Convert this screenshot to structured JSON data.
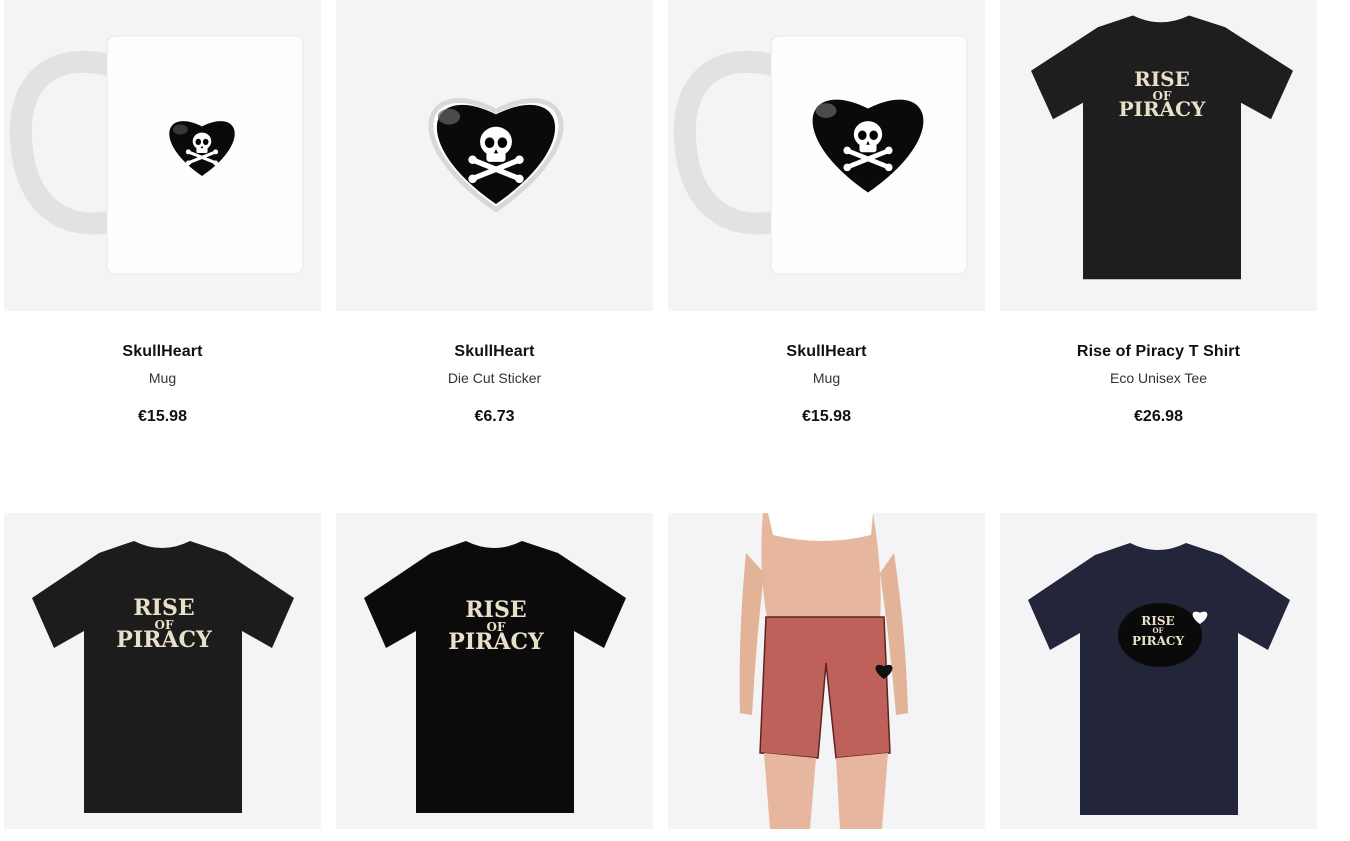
{
  "products": [
    {
      "title": "SkullHeart",
      "type": "Mug",
      "price": "€15.98"
    },
    {
      "title": "SkullHeart",
      "type": "Die Cut Sticker",
      "price": "€6.73"
    },
    {
      "title": "SkullHeart",
      "type": "Mug",
      "price": "€15.98"
    },
    {
      "title": "Rise of Piracy T Shirt",
      "type": "Eco Unisex Tee",
      "price": "€26.98"
    }
  ],
  "artwork": {
    "rise_line1": "RISE",
    "rise_line2": "OF",
    "rise_line3": "PIRACY"
  },
  "colors": {
    "card_bg": "#f4f4f7",
    "shirt_black": "#1a1a1a",
    "shirt_navy": "#23253a",
    "shorts_red": "#c0605a"
  }
}
